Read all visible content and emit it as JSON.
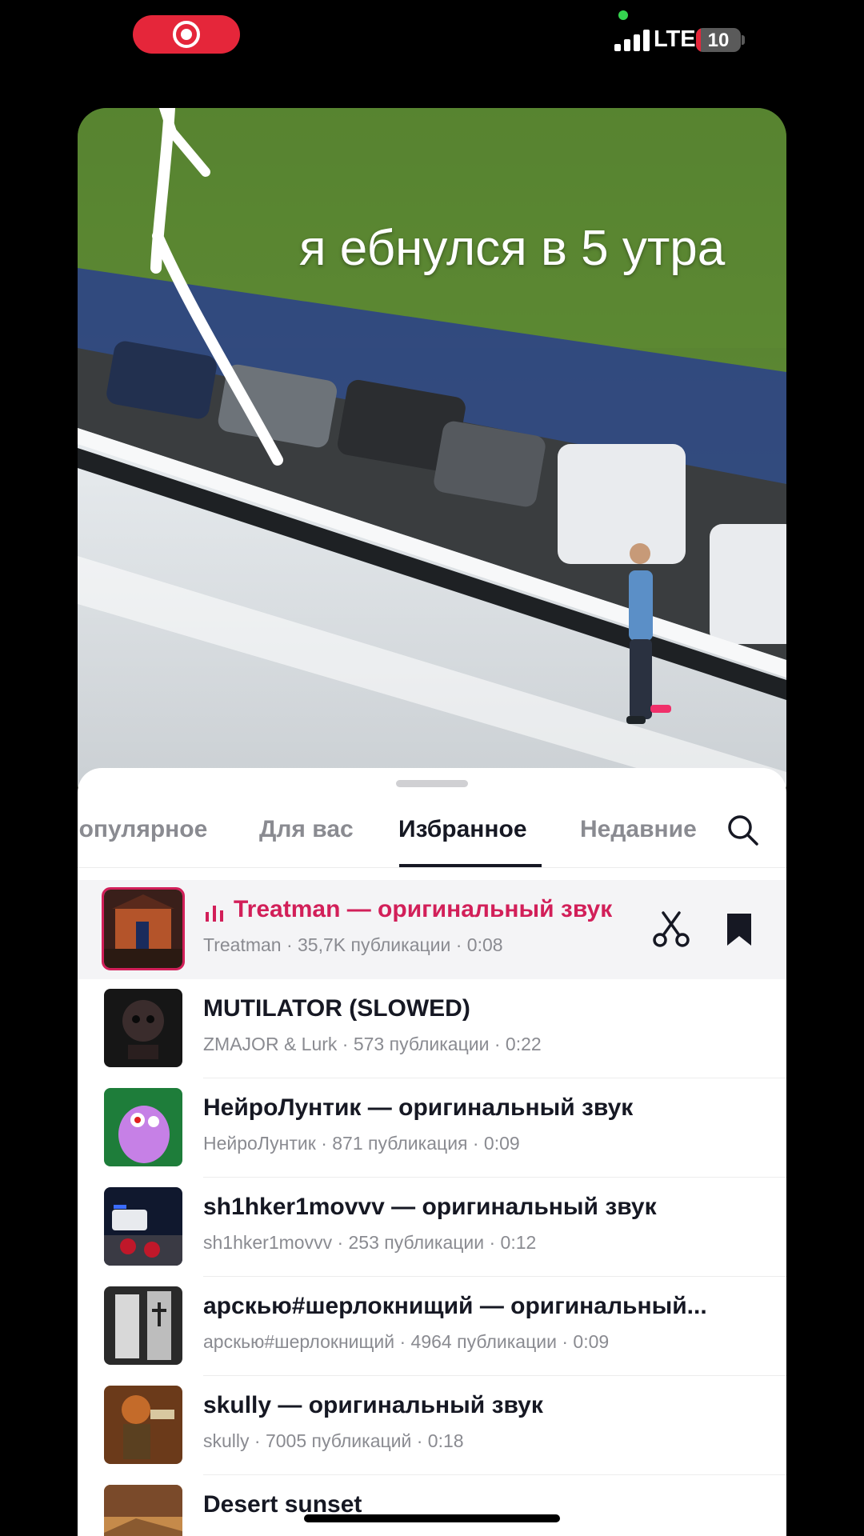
{
  "status_bar": {
    "network": "LTE",
    "battery_level": "10",
    "battery_percent": 10,
    "recording_color": "#e5263a",
    "camera_indicator_color": "#35d44f"
  },
  "video": {
    "caption": "я ебнулся в 5 утра"
  },
  "sound_picker": {
    "tabs": [
      {
        "label": "Популярное",
        "active": false
      },
      {
        "label": "Для вас",
        "active": false
      },
      {
        "label": "Избранное",
        "active": true
      },
      {
        "label": "Недавние",
        "active": false
      }
    ],
    "accent_color": "#d21f59",
    "sounds": [
      {
        "title": "Treatman — оригинальный звук",
        "meta": "Treatman · 35,7K публикации · 0:08",
        "playing": true
      },
      {
        "title": "MUTILATOR (SLOWED)",
        "meta": "ZMAJOR & Lurk · 573 публикации · 0:22",
        "playing": false
      },
      {
        "title": "НейроЛунтик — оригинальный звук",
        "meta": "НейроЛунтик · 871 публикация · 0:09",
        "playing": false
      },
      {
        "title": "sh1hker1movvv — оригинальный звук",
        "meta": "sh1hker1movvv · 253 публикации · 0:12",
        "playing": false
      },
      {
        "title": "арскью#шерлокнищий — оригинальный...",
        "meta": "арскью#шерлокнищий · 4964 публикации · 0:09",
        "playing": false
      },
      {
        "title": "skully — оригинальный звук",
        "meta": "skully · 7005 публикаций · 0:18",
        "playing": false
      },
      {
        "title": "Desert sunset",
        "meta": "",
        "playing": false
      }
    ]
  }
}
